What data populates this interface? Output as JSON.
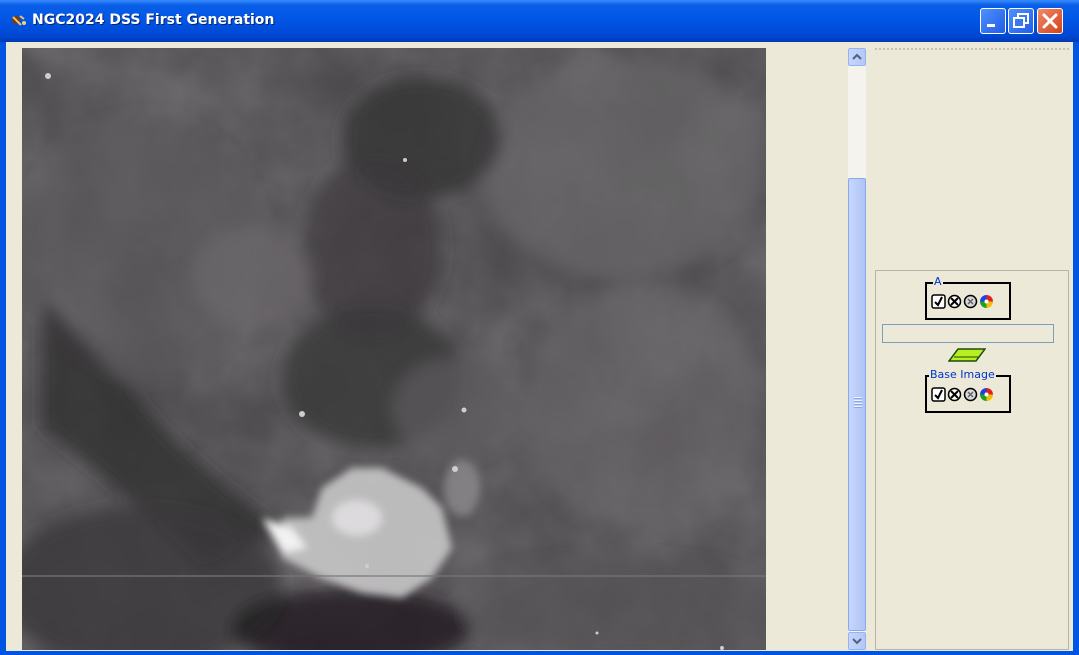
{
  "window": {
    "title": "NGC2024 DSS First Generation",
    "controls": [
      "minimize",
      "restore",
      "close"
    ]
  },
  "image_view": {
    "icon": "astronomy-image-icon"
  },
  "layers": [
    {
      "label": "A",
      "controls": [
        "check-icon",
        "delete-icon",
        "settings-icon",
        "color-wheel-icon"
      ]
    },
    {
      "label": "Base Image",
      "controls": [
        "check-icon",
        "delete-icon",
        "settings-icon",
        "color-wheel-icon"
      ]
    }
  ],
  "layer_input": {
    "value": ""
  },
  "colors": {
    "titlebar": "#0055e5",
    "client": "#ece9d8",
    "layer_label": "#0033cc"
  }
}
